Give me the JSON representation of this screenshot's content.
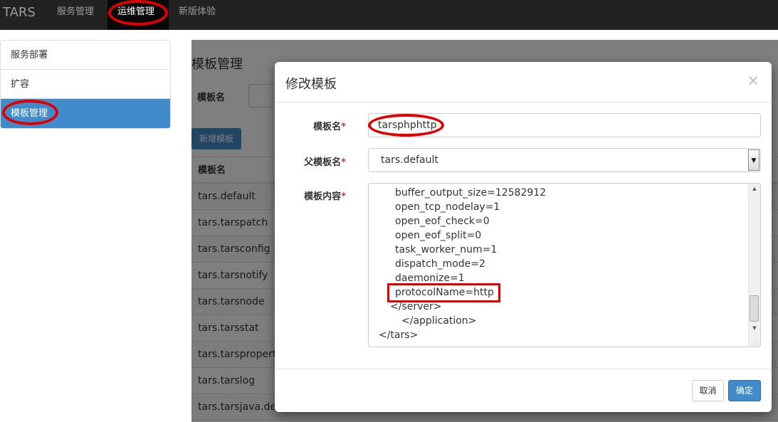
{
  "topnav": {
    "brand": "TARS",
    "items": [
      {
        "label": "服务管理"
      },
      {
        "label": "运维管理"
      },
      {
        "label": "新版体验"
      }
    ]
  },
  "sidebar": {
    "items": [
      {
        "label": "服务部署"
      },
      {
        "label": "扩容"
      },
      {
        "label": "模板管理"
      }
    ]
  },
  "page": {
    "title": "模板管理",
    "filter_label": "模板名",
    "add_button": "新增模板",
    "table_header": "模板名",
    "rows": [
      "tars.default",
      "tars.tarspatch",
      "tars.tarsconfig",
      "tars.tarsnotify",
      "tars.tarsnode",
      "tars.tarsstat",
      "tars.tarsproperty",
      "tars.tarslog",
      "tars.tarsjava.default"
    ]
  },
  "modal": {
    "title": "修改模板",
    "close": "×",
    "name_label": "模板名",
    "name_value": "tarsphphttp",
    "parent_label": "父模板名",
    "parent_value": "tars.default",
    "content_label": "模板内容",
    "required_mark": "*",
    "content_lines": [
      "buffer_output_size=12582912",
      "open_tcp_nodelay=1",
      "open_eof_check=0",
      "open_eof_split=0",
      "task_worker_num=1",
      "dispatch_mode=2",
      "daemonize=1",
      "protocolName=http",
      "</server>",
      "</application>",
      "</tars>"
    ],
    "cancel_button": "取消",
    "ok_button": "确定"
  },
  "colors": {
    "nav_bg": "#222222",
    "primary": "#428bca",
    "annotation": "#e00000"
  }
}
